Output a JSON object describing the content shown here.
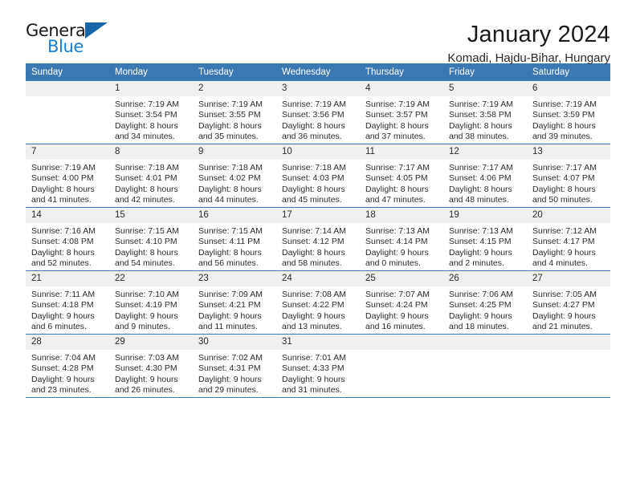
{
  "logo": {
    "word_one": "General",
    "word_two": "Blue",
    "triangle": "blue-triangle-icon"
  },
  "header": {
    "title": "January 2024",
    "location": "Komadi, Hajdu-Bihar, Hungary"
  },
  "colors": {
    "header_blue": "#3b79b4",
    "logo_blue": "#1a7fd4",
    "daynum_band": "#f0f0f0",
    "text": "#2b2b2b"
  },
  "weekday_headers": [
    "Sunday",
    "Monday",
    "Tuesday",
    "Wednesday",
    "Thursday",
    "Friday",
    "Saturday"
  ],
  "weeks": [
    [
      {
        "day": "",
        "sunrise": "",
        "sunset": "",
        "daylight_1": "",
        "daylight_2": ""
      },
      {
        "day": "1",
        "sunrise": "Sunrise: 7:19 AM",
        "sunset": "Sunset: 3:54 PM",
        "daylight_1": "Daylight: 8 hours",
        "daylight_2": "and 34 minutes."
      },
      {
        "day": "2",
        "sunrise": "Sunrise: 7:19 AM",
        "sunset": "Sunset: 3:55 PM",
        "daylight_1": "Daylight: 8 hours",
        "daylight_2": "and 35 minutes."
      },
      {
        "day": "3",
        "sunrise": "Sunrise: 7:19 AM",
        "sunset": "Sunset: 3:56 PM",
        "daylight_1": "Daylight: 8 hours",
        "daylight_2": "and 36 minutes."
      },
      {
        "day": "4",
        "sunrise": "Sunrise: 7:19 AM",
        "sunset": "Sunset: 3:57 PM",
        "daylight_1": "Daylight: 8 hours",
        "daylight_2": "and 37 minutes."
      },
      {
        "day": "5",
        "sunrise": "Sunrise: 7:19 AM",
        "sunset": "Sunset: 3:58 PM",
        "daylight_1": "Daylight: 8 hours",
        "daylight_2": "and 38 minutes."
      },
      {
        "day": "6",
        "sunrise": "Sunrise: 7:19 AM",
        "sunset": "Sunset: 3:59 PM",
        "daylight_1": "Daylight: 8 hours",
        "daylight_2": "and 39 minutes."
      }
    ],
    [
      {
        "day": "7",
        "sunrise": "Sunrise: 7:19 AM",
        "sunset": "Sunset: 4:00 PM",
        "daylight_1": "Daylight: 8 hours",
        "daylight_2": "and 41 minutes."
      },
      {
        "day": "8",
        "sunrise": "Sunrise: 7:18 AM",
        "sunset": "Sunset: 4:01 PM",
        "daylight_1": "Daylight: 8 hours",
        "daylight_2": "and 42 minutes."
      },
      {
        "day": "9",
        "sunrise": "Sunrise: 7:18 AM",
        "sunset": "Sunset: 4:02 PM",
        "daylight_1": "Daylight: 8 hours",
        "daylight_2": "and 44 minutes."
      },
      {
        "day": "10",
        "sunrise": "Sunrise: 7:18 AM",
        "sunset": "Sunset: 4:03 PM",
        "daylight_1": "Daylight: 8 hours",
        "daylight_2": "and 45 minutes."
      },
      {
        "day": "11",
        "sunrise": "Sunrise: 7:17 AM",
        "sunset": "Sunset: 4:05 PM",
        "daylight_1": "Daylight: 8 hours",
        "daylight_2": "and 47 minutes."
      },
      {
        "day": "12",
        "sunrise": "Sunrise: 7:17 AM",
        "sunset": "Sunset: 4:06 PM",
        "daylight_1": "Daylight: 8 hours",
        "daylight_2": "and 48 minutes."
      },
      {
        "day": "13",
        "sunrise": "Sunrise: 7:17 AM",
        "sunset": "Sunset: 4:07 PM",
        "daylight_1": "Daylight: 8 hours",
        "daylight_2": "and 50 minutes."
      }
    ],
    [
      {
        "day": "14",
        "sunrise": "Sunrise: 7:16 AM",
        "sunset": "Sunset: 4:08 PM",
        "daylight_1": "Daylight: 8 hours",
        "daylight_2": "and 52 minutes."
      },
      {
        "day": "15",
        "sunrise": "Sunrise: 7:15 AM",
        "sunset": "Sunset: 4:10 PM",
        "daylight_1": "Daylight: 8 hours",
        "daylight_2": "and 54 minutes."
      },
      {
        "day": "16",
        "sunrise": "Sunrise: 7:15 AM",
        "sunset": "Sunset: 4:11 PM",
        "daylight_1": "Daylight: 8 hours",
        "daylight_2": "and 56 minutes."
      },
      {
        "day": "17",
        "sunrise": "Sunrise: 7:14 AM",
        "sunset": "Sunset: 4:12 PM",
        "daylight_1": "Daylight: 8 hours",
        "daylight_2": "and 58 minutes."
      },
      {
        "day": "18",
        "sunrise": "Sunrise: 7:13 AM",
        "sunset": "Sunset: 4:14 PM",
        "daylight_1": "Daylight: 9 hours",
        "daylight_2": "and 0 minutes."
      },
      {
        "day": "19",
        "sunrise": "Sunrise: 7:13 AM",
        "sunset": "Sunset: 4:15 PM",
        "daylight_1": "Daylight: 9 hours",
        "daylight_2": "and 2 minutes."
      },
      {
        "day": "20",
        "sunrise": "Sunrise: 7:12 AM",
        "sunset": "Sunset: 4:17 PM",
        "daylight_1": "Daylight: 9 hours",
        "daylight_2": "and 4 minutes."
      }
    ],
    [
      {
        "day": "21",
        "sunrise": "Sunrise: 7:11 AM",
        "sunset": "Sunset: 4:18 PM",
        "daylight_1": "Daylight: 9 hours",
        "daylight_2": "and 6 minutes."
      },
      {
        "day": "22",
        "sunrise": "Sunrise: 7:10 AM",
        "sunset": "Sunset: 4:19 PM",
        "daylight_1": "Daylight: 9 hours",
        "daylight_2": "and 9 minutes."
      },
      {
        "day": "23",
        "sunrise": "Sunrise: 7:09 AM",
        "sunset": "Sunset: 4:21 PM",
        "daylight_1": "Daylight: 9 hours",
        "daylight_2": "and 11 minutes."
      },
      {
        "day": "24",
        "sunrise": "Sunrise: 7:08 AM",
        "sunset": "Sunset: 4:22 PM",
        "daylight_1": "Daylight: 9 hours",
        "daylight_2": "and 13 minutes."
      },
      {
        "day": "25",
        "sunrise": "Sunrise: 7:07 AM",
        "sunset": "Sunset: 4:24 PM",
        "daylight_1": "Daylight: 9 hours",
        "daylight_2": "and 16 minutes."
      },
      {
        "day": "26",
        "sunrise": "Sunrise: 7:06 AM",
        "sunset": "Sunset: 4:25 PM",
        "daylight_1": "Daylight: 9 hours",
        "daylight_2": "and 18 minutes."
      },
      {
        "day": "27",
        "sunrise": "Sunrise: 7:05 AM",
        "sunset": "Sunset: 4:27 PM",
        "daylight_1": "Daylight: 9 hours",
        "daylight_2": "and 21 minutes."
      }
    ],
    [
      {
        "day": "28",
        "sunrise": "Sunrise: 7:04 AM",
        "sunset": "Sunset: 4:28 PM",
        "daylight_1": "Daylight: 9 hours",
        "daylight_2": "and 23 minutes."
      },
      {
        "day": "29",
        "sunrise": "Sunrise: 7:03 AM",
        "sunset": "Sunset: 4:30 PM",
        "daylight_1": "Daylight: 9 hours",
        "daylight_2": "and 26 minutes."
      },
      {
        "day": "30",
        "sunrise": "Sunrise: 7:02 AM",
        "sunset": "Sunset: 4:31 PM",
        "daylight_1": "Daylight: 9 hours",
        "daylight_2": "and 29 minutes."
      },
      {
        "day": "31",
        "sunrise": "Sunrise: 7:01 AM",
        "sunset": "Sunset: 4:33 PM",
        "daylight_1": "Daylight: 9 hours",
        "daylight_2": "and 31 minutes."
      },
      {
        "day": "",
        "sunrise": "",
        "sunset": "",
        "daylight_1": "",
        "daylight_2": ""
      },
      {
        "day": "",
        "sunrise": "",
        "sunset": "",
        "daylight_1": "",
        "daylight_2": ""
      },
      {
        "day": "",
        "sunrise": "",
        "sunset": "",
        "daylight_1": "",
        "daylight_2": ""
      }
    ]
  ]
}
